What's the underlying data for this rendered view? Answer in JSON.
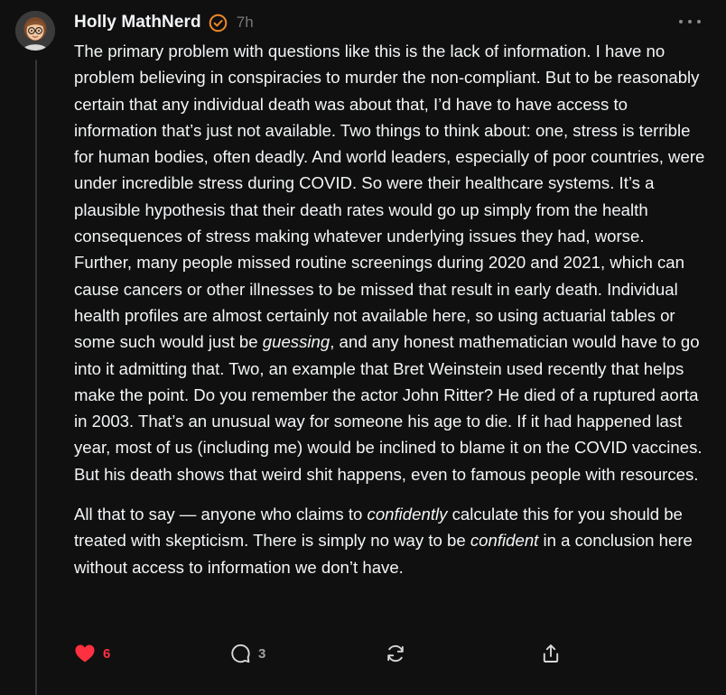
{
  "post": {
    "author": "Holly MathNerd",
    "timestamp": "7h",
    "verified_icon": "verified-check-icon",
    "paragraphs": [
      {
        "segments": [
          {
            "text": "The primary problem with questions like this is the lack of information. I have no problem believing in conspiracies to murder the non-compliant. But to be reasonably certain that any individual death was about that, I’d have to have access to information that’s just not available. Two things to think about: one, stress is terrible for human bodies, often deadly. And world leaders, especially of poor countries, were under incredible stress during COVID. So were their healthcare systems. It’s a plausible hypothesis that their death rates would go up simply from the health consequences of stress making whatever underlying issues they had, worse. Further, many people missed routine screenings during 2020 and 2021, which can cause cancers or other illnesses to be missed that result in early death. Individual health profiles are almost certainly not available here, so using actuarial tables or some such would just be "
          },
          {
            "text": "guessing",
            "italic": true
          },
          {
            "text": ", and any honest mathematician would have to go into it admitting that. Two, an example that Bret Weinstein used recently that helps make the point. Do you remember the actor John Ritter? He died of a ruptured aorta in 2003. That’s an unusual way for someone his age to die. If it had happened last year, most of us (including me) would be inclined to blame it on the COVID vaccines. But his death shows that weird shit happens, even to famous people with resources."
          }
        ]
      },
      {
        "segments": [
          {
            "text": "All that to say — anyone who claims to "
          },
          {
            "text": "confidently",
            "italic": true
          },
          {
            "text": " calculate this for you should be treated with skepticism. There is simply no way to be "
          },
          {
            "text": "confident",
            "italic": true
          },
          {
            "text": " in a conclusion here without access to information we don’t have."
          }
        ]
      }
    ],
    "actions": {
      "like_count": "6",
      "reply_count": "3",
      "like_icon": "heart-icon",
      "reply_icon": "comment-icon",
      "repost_icon": "repost-icon",
      "share_icon": "share-icon"
    }
  },
  "colors": {
    "background": "#101010",
    "text": "#f3f5f7",
    "muted": "#777777",
    "like": "#ff3040",
    "verified": "#f0882a"
  }
}
